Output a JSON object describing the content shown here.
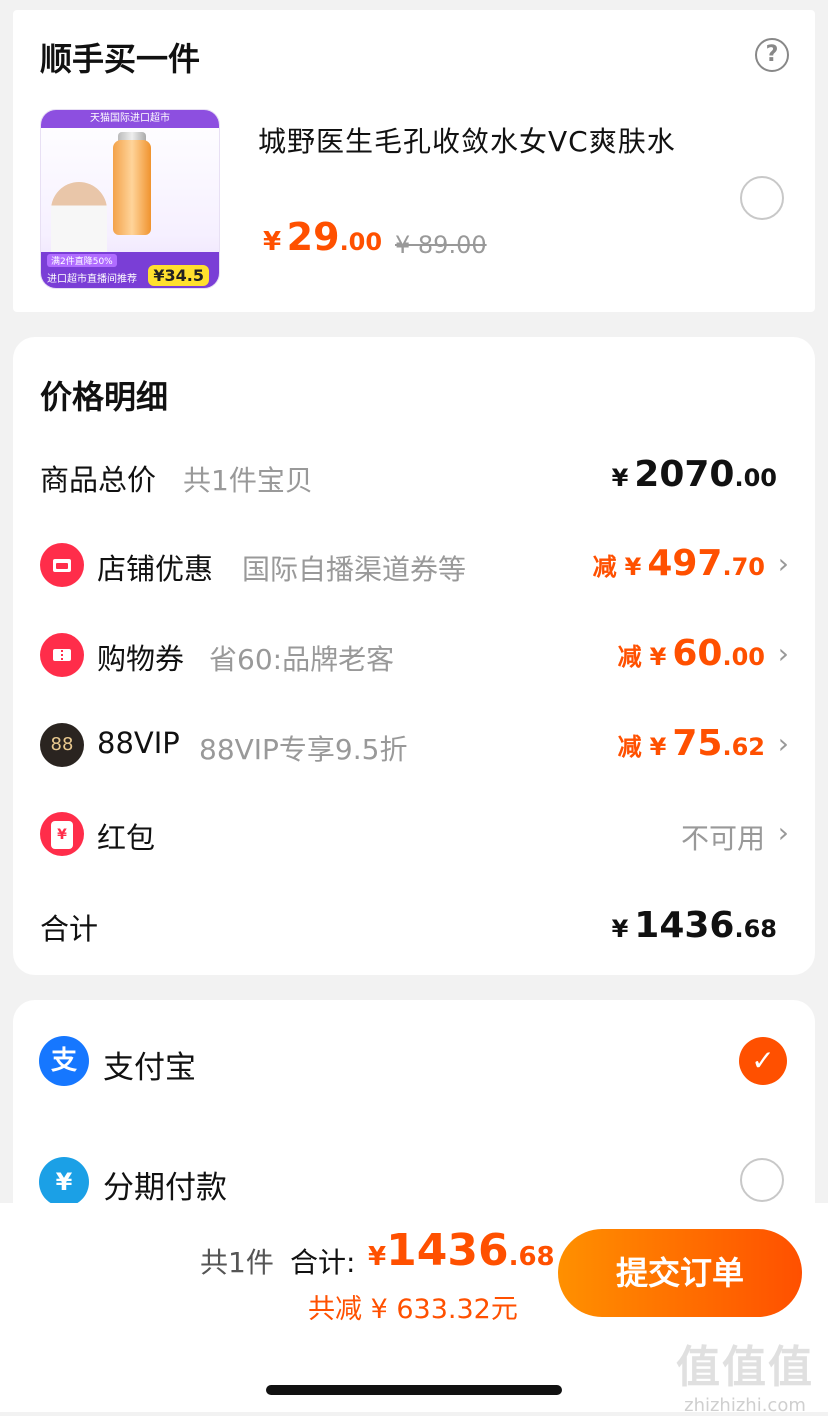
{
  "upsell": {
    "title": "顺手买一件",
    "product": {
      "name": "城野医生毛孔收敛水女VC爽肤水",
      "price_yen": "¥",
      "price_int": "29",
      "price_dec": ".00",
      "original_price": "¥ 89.00",
      "image": {
        "top_strip": "天猫国际进口超市",
        "badge1": "满2件直降50%",
        "badge2": "进口超市直播间推荐",
        "tag_price": "¥34.5"
      }
    }
  },
  "price_detail": {
    "title": "价格明细",
    "rows": [
      {
        "label": "商品总价",
        "sub": "共1件宝贝",
        "yen": "¥",
        "int": "2070",
        "dec": ".00"
      },
      {
        "label": "店铺优惠",
        "sub": "国际自播渠道券等",
        "prefix": "减",
        "yen": "¥",
        "int": "497",
        "dec": ".70"
      },
      {
        "label": "购物券",
        "sub": "省60:品牌老客",
        "prefix": "减",
        "yen": "¥",
        "int": "60",
        "dec": ".00"
      },
      {
        "label": "88VIP",
        "sub": "88VIP专享9.5折",
        "prefix": "减",
        "yen": "¥",
        "int": "75",
        "dec": ".62"
      },
      {
        "label": "红包",
        "status": "不可用"
      },
      {
        "label": "合计",
        "yen": "¥",
        "int": "1436",
        "dec": ".68"
      }
    ],
    "icons": {
      "shop_icon": "shop-icon",
      "coupon_icon": "coupon-icon",
      "vip_icon_text": "88",
      "redpacket_icon_text": "¥"
    }
  },
  "payment": {
    "options": [
      {
        "label": "支付宝",
        "icon_text": "支",
        "selected": true
      },
      {
        "label": "分期付款",
        "icon_text": "¥",
        "selected": false
      }
    ]
  },
  "footer": {
    "count": "共1件",
    "total_label": "合计:",
    "total_yen": "¥",
    "total_int": "1436",
    "total_dec": ".68",
    "saving": "共减 ¥ 633.32元",
    "submit_label": "提交订单",
    "watermark_text": "值值值",
    "watermark_url": "zhizhizhi.com"
  },
  "colors": {
    "accent": "#ff5000",
    "muted": "#999999"
  }
}
